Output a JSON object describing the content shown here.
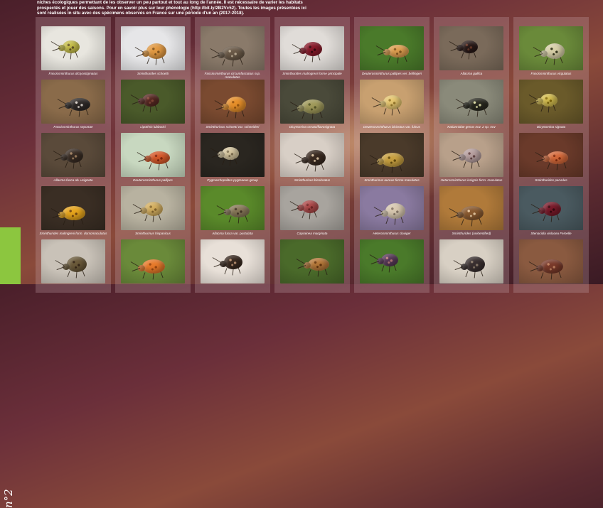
{
  "intro": {
    "lines": [
      "niches écologiques permettant de les observer un peu partout et tout au long de l'année. Il est nécessaire de varier les habitats",
      "prospectés et jouer des saisons. Pour en savoir plus sur leur phénologie (http://bit.ly/2B2Vc52). Toutes les images présentées ici",
      "sont réalisées in situ avec des spécimens observés en France sur une période d'un an (2017-2018)."
    ]
  },
  "issue_label": "n°2",
  "species": [
    [
      {
        "name": "Fasciosminthurus dictyostigmatus",
        "bg": "#e8e6df",
        "body": "#c9c14a",
        "dots": "#6b5a2a"
      },
      {
        "name": "Fasciosminthurus seportae",
        "bg": "#8a6b4a",
        "body": "#2f2a28",
        "dots": "#d8d0c8"
      },
      {
        "name": "Allacma fusca ab. usignata",
        "bg": "#5a4a3a",
        "body": "#3a2d24",
        "dots": "#a08060"
      },
      {
        "name": "Sminthurides malmgreni form. dorsomaculatus",
        "bg": "#3a2e24",
        "body": "#e7a51c",
        "dots": "#7a4a10"
      },
      {
        "name": "",
        "bg": "#c9c2b8",
        "body": "#6b5a3a",
        "dots": "#3a2a1a"
      }
    ],
    [
      {
        "name": "Sminthurides schoetti",
        "bg": "#e6e6e8",
        "body": "#e39a42",
        "dots": "#8a5a20"
      },
      {
        "name": "Lipothrix lubbocki",
        "bg": "#4a5a2a",
        "body": "#5a2a24",
        "dots": "#8a4a3a"
      },
      {
        "name": "Deuterosminthurus pallipes",
        "bg": "#c8d8c0",
        "body": "#d85a2a",
        "dots": "#8a2a10"
      },
      {
        "name": "Sminthurinus hispanicus",
        "bg": "#b8b2a0",
        "body": "#d6b060",
        "dots": "#8a6a30"
      },
      {
        "name": "",
        "bg": "#6a8a3a",
        "body": "#e87a2a",
        "dots": "#a04a10"
      }
    ],
    [
      {
        "name": "Fasciosminthurus circumfasciatus ssp. maculatus",
        "bg": "#8a7a6a",
        "body": "#6b5a48",
        "dots": "#c0b098"
      },
      {
        "name": "Sminthurinus schoetti var. schneideri",
        "bg": "#7a4a30",
        "body": "#e8902a",
        "dots": "#a05a10"
      },
      {
        "name": "Pygmarrhopalites pygmaeus-group",
        "bg": "#2a2620",
        "body": "#d8c8a0",
        "dots": "#8a7a5a"
      },
      {
        "name": "Allacma fusca var. pustulata",
        "bg": "#5a8a2a",
        "body": "#8a7a5a",
        "dots": "#4a3a2a"
      },
      {
        "name": "",
        "bg": "#e8e0d8",
        "body": "#3a2a20",
        "dots": "#b89070"
      }
    ],
    [
      {
        "name": "Sminthurides malmgreni forme principale",
        "bg": "#e0dcd8",
        "body": "#8a1a2a",
        "dots": "#3a0a10"
      },
      {
        "name": "Dicyrtomina ornata/flavosignata",
        "bg": "#4a4a3a",
        "body": "#a09a5a",
        "dots": "#5a5a2a"
      },
      {
        "name": "Sminthurinus bicoloratus",
        "bg": "#d8cfc6",
        "body": "#3a2a20",
        "dots": "#d8c0a0"
      },
      {
        "name": "Caprainea marginata",
        "bg": "#a8a49e",
        "body": "#b04a4a",
        "dots": "#7a2a2a"
      },
      {
        "name": "",
        "bg": "#4a6a2a",
        "body": "#b87a3a",
        "dots": "#6a3a10"
      }
    ],
    [
      {
        "name": "Deuterosminthurus pallipes ver. bellingeri",
        "bg": "#4a7a2a",
        "body": "#e0a050",
        "dots": "#8a5a20"
      },
      {
        "name": "Deuterosminthurus bicinctus var. fulvus",
        "bg": "#c8a070",
        "body": "#e8c870",
        "dots": "#a08030"
      },
      {
        "name": "Sminthurinus aureus forme maculatus",
        "bg": "#4a3a2a",
        "body": "#c8a040",
        "dots": "#6a5010"
      },
      {
        "name": "Heterosminthurus claviger",
        "bg": "#8a7aa0",
        "body": "#d8c8b0",
        "dots": "#8a7a6a"
      },
      {
        "name": "",
        "bg": "#4a7a2a",
        "body": "#5a3a5a",
        "dots": "#c08080"
      }
    ],
    [
      {
        "name": "Allacma gallica",
        "bg": "#7a6a5a",
        "body": "#2a1a18",
        "dots": "#6a3a2a"
      },
      {
        "name": "Katiannidae genus nov. 2 sp. nov",
        "bg": "#8a8a7a",
        "body": "#2a2a20",
        "dots": "#d8d8a0"
      },
      {
        "name": "Heterosminthurus insignis form. maculatus",
        "bg": "#b8a08a",
        "body": "#b8a0a0",
        "dots": "#6a4a4a"
      },
      {
        "name": "Sminthurides (unidentified)",
        "bg": "#b07a3a",
        "body": "#8a5a30",
        "dots": "#e8c8a0"
      },
      {
        "name": "",
        "bg": "#d8d0c4",
        "body": "#3a3030",
        "dots": "#8a7a6a"
      }
    ],
    [
      {
        "name": "Fasciosminthurus virgulatus",
        "bg": "#6a8a3a",
        "body": "#d8d0a8",
        "dots": "#3a3a20"
      },
      {
        "name": "Dicyrtomina signata",
        "bg": "#6a5a2a",
        "body": "#d8c050",
        "dots": "#8a7010"
      },
      {
        "name": "Sminthurides parvulus",
        "bg": "#6a3a2a",
        "body": "#d86a3a",
        "dots": "#8a3010"
      },
      {
        "name": "Stenacidia violacea Femelle",
        "bg": "#4a5a60",
        "body": "#7a1a2a",
        "dots": "#3a0a10"
      },
      {
        "name": "",
        "bg": "#8a5a40",
        "body": "#7a3a2a",
        "dots": "#c08060"
      }
    ]
  ]
}
